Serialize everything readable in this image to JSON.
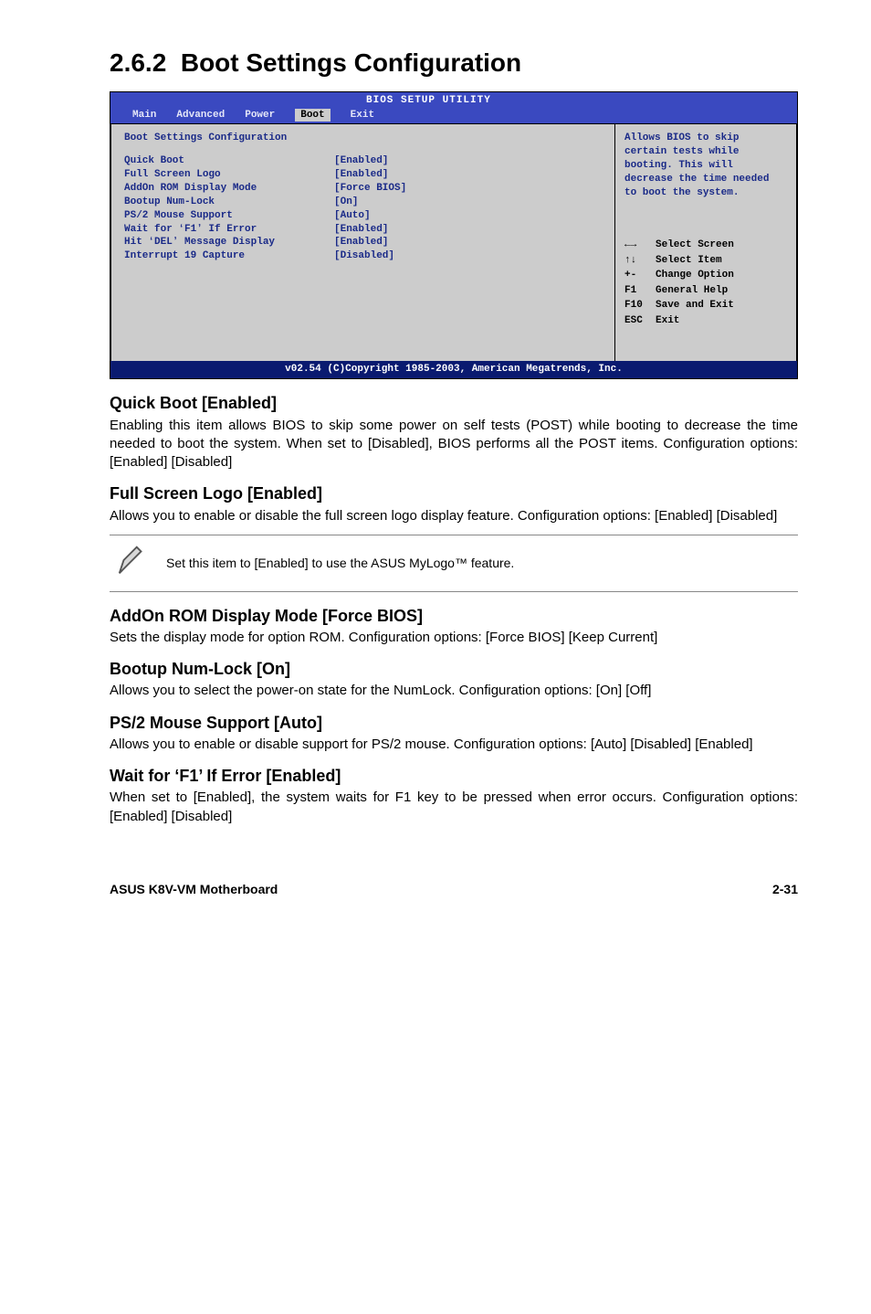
{
  "page": {
    "section_number": "2.6.2",
    "section_title": "Boot Settings Configuration"
  },
  "bios": {
    "util_title": "BIOS SETUP UTILITY",
    "tabs": {
      "main": "Main",
      "advanced": "Advanced",
      "power": "Power",
      "boot": "Boot",
      "exit": "Exit"
    },
    "left_header": "Boot Settings Configuration",
    "items": [
      {
        "label": "Quick Boot",
        "value": "[Enabled]"
      },
      {
        "label": "Full Screen Logo",
        "value": "[Enabled]"
      },
      {
        "label": "AddOn ROM Display Mode",
        "value": "[Force BIOS]"
      },
      {
        "label": "Bootup Num-Lock",
        "value": "[On]"
      },
      {
        "label": "PS/2 Mouse Support",
        "value": "[Auto]"
      },
      {
        "label": "Wait for ʻF1ʼ If Error",
        "value": "[Enabled]"
      },
      {
        "label": "Hit ʻDELʼ Message Display",
        "value": "[Enabled]"
      },
      {
        "label": "Interrupt 19 Capture",
        "value": "[Disabled]"
      }
    ],
    "help_text": "Allows BIOS to skip certain tests while booting. This will decrease the time needed to boot the system.",
    "keys": [
      {
        "key": "←→",
        "desc": "Select Screen"
      },
      {
        "key": "↑↓",
        "desc": "Select Item"
      },
      {
        "key": "+-",
        "desc": "Change Option"
      },
      {
        "key": "F1",
        "desc": "General Help"
      },
      {
        "key": "F10",
        "desc": "Save and Exit"
      },
      {
        "key": "ESC",
        "desc": "Exit"
      }
    ],
    "footer": "v02.54 (C)Copyright 1985-2003, American Megatrends, Inc."
  },
  "sections": {
    "quick_boot": {
      "heading": "Quick Boot [Enabled]",
      "body": "Enabling this item allows BIOS to skip some power on self tests (POST) while booting to decrease the time needed to boot the system. When set to [Disabled], BIOS performs all the POST items. Configuration options: [Enabled] [Disabled]"
    },
    "full_screen_logo": {
      "heading": "Full Screen Logo [Enabled]",
      "body": "Allows you to enable or disable the full screen logo display feature. Configuration options: [Enabled] [Disabled]"
    },
    "note": "Set this item to [Enabled] to use the ASUS MyLogo™ feature.",
    "addon_rom": {
      "heading": "AddOn ROM Display Mode [Force BIOS]",
      "body": "Sets the display mode for option ROM. Configuration options: [Force BIOS] [Keep Current]"
    },
    "bootup_numlock": {
      "heading": "Bootup Num-Lock [On]",
      "body": "Allows you to select the power-on state for the NumLock. Configuration options: [On] [Off]"
    },
    "ps2_mouse": {
      "heading": "PS/2 Mouse Support [Auto]",
      "body": "Allows you to enable or disable support for PS/2 mouse. Configuration options: [Auto] [Disabled] [Enabled]"
    },
    "wait_f1": {
      "heading": "Wait for ‘F1’ If Error [Enabled]",
      "body": "When set to [Enabled], the system waits for F1 key to be pressed when error occurs. Configuration options: [Enabled] [Disabled]"
    }
  },
  "footer": {
    "left": "ASUS K8V-VM Motherboard",
    "right": "2-31"
  }
}
